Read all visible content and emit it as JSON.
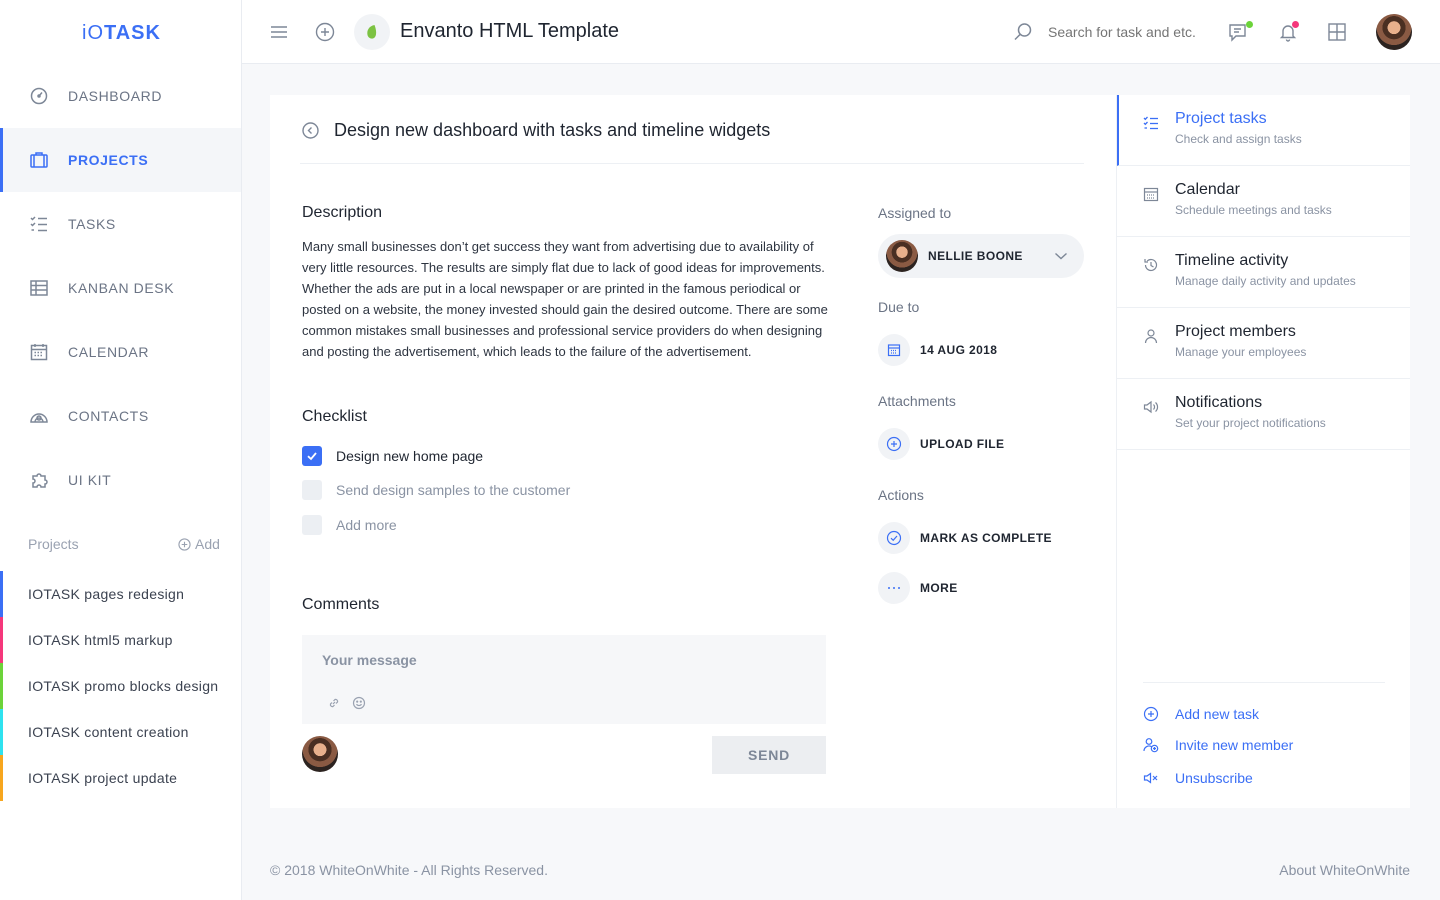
{
  "app": {
    "logo_light": "iO",
    "logo_bold": "TASK"
  },
  "sidebar": {
    "items": [
      {
        "label": "DASHBOARD",
        "icon": "dashboard-icon"
      },
      {
        "label": "PROJECTS",
        "icon": "briefcase-icon",
        "active": true
      },
      {
        "label": "TASKS",
        "icon": "checklist-icon"
      },
      {
        "label": "KANBAN DESK",
        "icon": "kanban-icon"
      },
      {
        "label": "CALENDAR",
        "icon": "calendar-icon"
      },
      {
        "label": "CONTACTS",
        "icon": "contacts-icon"
      },
      {
        "label": "UI KIT",
        "icon": "puzzle-icon"
      }
    ],
    "projects_heading": "Projects",
    "projects_add": "Add",
    "projects": [
      {
        "label": "IOTASK pages redesign",
        "color": "#3b6ff5"
      },
      {
        "label": "IOTASK html5 markup",
        "color": "#f5377b"
      },
      {
        "label": "IOTASK promo blocks design",
        "color": "#6cd33a"
      },
      {
        "label": "IOTASK content creation",
        "color": "#2fe2ef"
      },
      {
        "label": "IOTASK project update",
        "color": "#f7a61e"
      }
    ]
  },
  "header": {
    "title": "Envanto HTML Template",
    "search_placeholder": "Search for task and etc."
  },
  "task": {
    "title": "Design new dashboard with tasks and timeline widgets",
    "description_heading": "Description",
    "description": "Many small businesses don’t get success they want from advertising due to availability of very little resources. The results are simply flat due to lack of good ideas for improvements. Whether the ads are put in a local newspaper or are printed in the famous periodical or posted on a website, the money invested should gain the desired outcome. There are some common mistakes small businesses and professional service providers do when designing and posting the advertisement, which leads to the failure of the advertisement.",
    "checklist_heading": "Checklist",
    "checklist": [
      {
        "label": "Design new home page",
        "checked": true
      },
      {
        "label": "Send design samples to the customer",
        "checked": false
      },
      {
        "label": "Add more",
        "checked": false
      }
    ],
    "comments_heading": "Comments",
    "message_placeholder": "Your message",
    "send_label": "SEND",
    "assigned_label": "Assigned to",
    "assignee": "NELLIE BOONE",
    "due_label": "Due to",
    "due_date": "14 AUG 2018",
    "attachments_label": "Attachments",
    "upload_label": "UPLOAD FILE",
    "actions_label": "Actions",
    "complete_label": "MARK AS COMPLETE",
    "more_label": "MORE"
  },
  "right_panel": {
    "items": [
      {
        "title": "Project tasks",
        "subtitle": "Check and assign tasks",
        "icon": "checklist-icon",
        "active": true
      },
      {
        "title": "Calendar",
        "subtitle": "Schedule meetings and tasks",
        "icon": "calendar-icon"
      },
      {
        "title": "Timeline activity",
        "subtitle": "Manage daily activity and updates",
        "icon": "history-icon"
      },
      {
        "title": "Project members",
        "subtitle": "Manage your employees",
        "icon": "user-icon"
      },
      {
        "title": "Notifications",
        "subtitle": "Set your project notifications",
        "icon": "speaker-icon"
      }
    ],
    "links": [
      {
        "label": "Add new task",
        "icon": "plus-circle-icon"
      },
      {
        "label": "Invite new member",
        "icon": "add-user-icon"
      },
      {
        "label": "Unsubscribe",
        "icon": "mute-icon"
      }
    ]
  },
  "footer": {
    "copyright": "© 2018 WhiteOnWhite - All Rights Reserved.",
    "about": "About WhiteOnWhite"
  },
  "colors": {
    "accent": "#3b6ff5",
    "online_dot": "#6cd33a",
    "notification_dot": "#f5377b"
  }
}
